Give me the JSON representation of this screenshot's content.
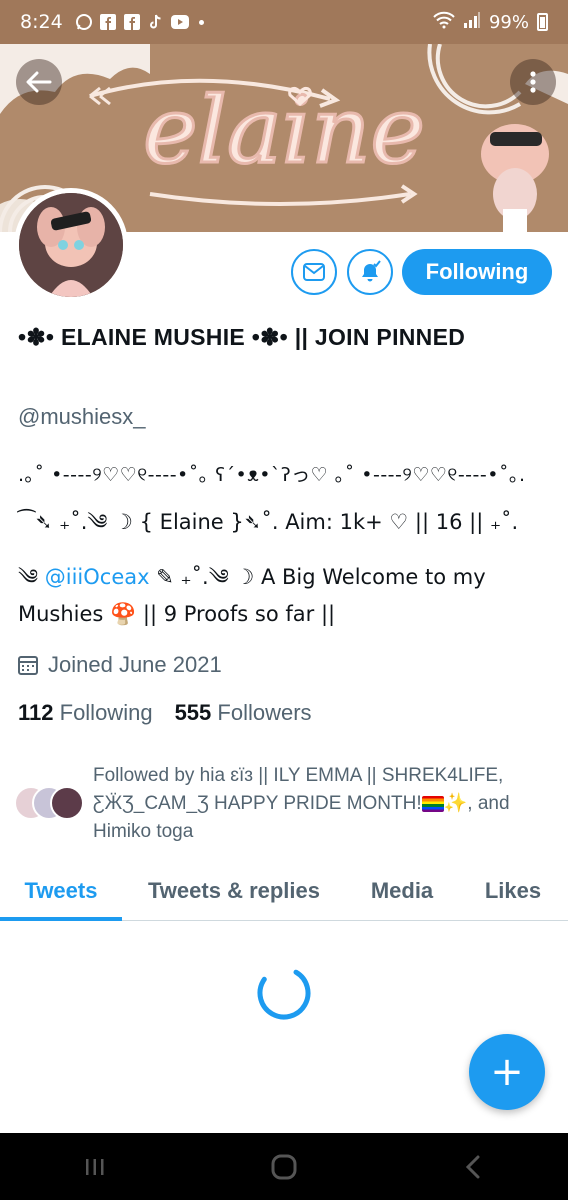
{
  "status_bar": {
    "time": "8:24",
    "battery": "99%",
    "left_icons": [
      "whatsapp-icon",
      "facebook-icon",
      "facebook-icon",
      "tiktok-icon",
      "youtube-icon"
    ],
    "right_icons": [
      "wifi-icon",
      "signal-icon",
      "battery-icon"
    ]
  },
  "banner": {
    "title_art": "elaine"
  },
  "header": {
    "back_icon": "arrow-left-icon",
    "more_icon": "more-vertical-icon"
  },
  "actions": {
    "message_icon": "mail-icon",
    "notify_icon": "bell-check-icon",
    "follow_label": "Following"
  },
  "profile": {
    "display_name": "•✽• ELAINE MUSHIE •✽• || JOIN PINNED",
    "handle": "@mushiesx_",
    "bio_line1": ".｡˚ •----୨♡♡୧----•˚｡ ʕ´•ᴥ•`ʔっ♡ ｡˚ •----୨♡♡୧----•˚｡.",
    "bio_line2": "⁀➴ ₊˚.༄ ☽ { Elaine }➴˚. Aim: 1k+ ♡ || 16 || ₊˚.",
    "bio_line3_prefix": "༄ ",
    "bio_mention": "@iiiOceax",
    "bio_line3_suffix": " ✎ ₊˚.༄ ☽ A Big Welcome to my",
    "bio_line4": "Mushies 🍄 || 9 Proofs so far ||",
    "joined": "Joined June 2021",
    "following_count": "112",
    "following_label": "Following",
    "followers_count": "555",
    "followers_label": "Followers",
    "followed_by_part1": "Followed by hia ɛïɜ || ILY EMMA || SHREK4LIFE, ƸӜƷ_CAM_Ʒ HAPPY PRIDE MONTH!",
    "followed_by_part2": "✨, and Himiko toga"
  },
  "tabs": [
    {
      "label": "Tweets"
    },
    {
      "label": "Tweets & replies"
    },
    {
      "label": "Media"
    },
    {
      "label": "Likes"
    }
  ],
  "fab": {
    "label": "+"
  },
  "colors": {
    "accent": "#1d9bf0",
    "banner": "#b08a6b",
    "status_bar": "#a0785a",
    "muted_text": "#536471"
  }
}
